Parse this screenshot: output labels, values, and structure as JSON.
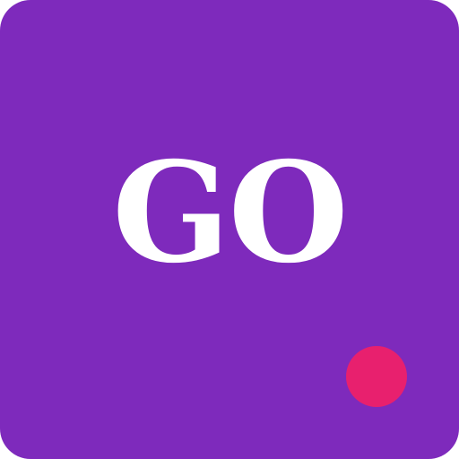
{
  "icon": {
    "label": "GO",
    "background_color": "#7e2abc",
    "text_color": "#ffffff"
  },
  "badge": {
    "icon": "notification-dot-icon",
    "color": "#e8206e"
  }
}
